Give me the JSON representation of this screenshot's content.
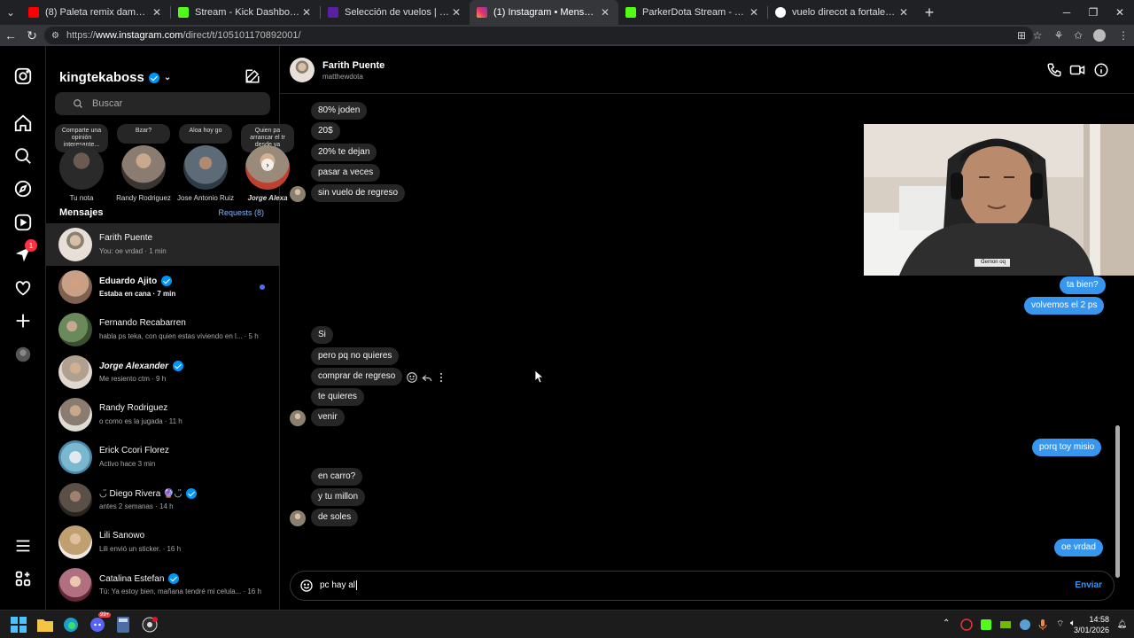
{
  "browser": {
    "tabs": [
      {
        "title": "(8) Paleta remix dame paleta palet",
        "favicon": "youtube-icon",
        "color": "#ff0000"
      },
      {
        "title": "Stream - Kick Dashboard",
        "favicon": "kick-icon",
        "color": "#53fc18"
      },
      {
        "title": "Selección de vuelos | LATAM Airlin",
        "favicon": "latam-icon",
        "color": "#5a1fa3"
      },
      {
        "title": "(1) Instagram • Mensajes",
        "favicon": "instagram-icon",
        "color": "#e1306c"
      },
      {
        "title": "ParkerDota Stream - Watch Live or",
        "favicon": "kick-icon",
        "color": "#53fc18"
      },
      {
        "title": "vuelo direcot a fortaleza de lima -",
        "favicon": "google-icon",
        "color": "#ffffff"
      }
    ],
    "url_prefix": "https://",
    "url_host": "www.instagram.com",
    "url_path": "/direct/t/105101170892001/"
  },
  "sidebar": {
    "notification_count": "1"
  },
  "inbox": {
    "username": "kingtekaboss",
    "search_placeholder": "Buscar",
    "notes": [
      {
        "bubble": "Comparte una opinión interesante...",
        "name": "Tu nota",
        "color": "#3b3b3b"
      },
      {
        "bubble": "Bzar?",
        "name": "Randy Rodriguez",
        "color": "#8a7c70"
      },
      {
        "bubble": "Aloa hoy go",
        "name": "Jose Antonio Ruiz",
        "color": "#5d6b78"
      },
      {
        "bubble": "Quien pa arrancar el tr desde ya",
        "name": "Jorge Alexa",
        "color": "#9a8a7a"
      }
    ],
    "messages_header": "Mensajes",
    "requests_link": "Requests (8)",
    "conversations": [
      {
        "name": "Farith Puente",
        "preview": "You: oe vrdad · 1 min",
        "verified": false,
        "unread": false,
        "color": "#a89b8c"
      },
      {
        "name": "Eduardo Ajito",
        "preview": "Estaba en cana · 7 min",
        "verified": true,
        "unread": true,
        "color": "#c8a088"
      },
      {
        "name": "Fernando Recabarren",
        "preview": "habla ps teka, con quien estas viviendo en l... · 5 h",
        "verified": false,
        "unread": false,
        "color": "#6b8a5c"
      },
      {
        "name": "Jorge Alexander",
        "preview": "Me resiento ctm · 9 h",
        "verified": true,
        "unread": false,
        "color": "#b0a090"
      },
      {
        "name": "Randy Rodriguez",
        "preview": "o como es la jugada · 11 h",
        "verified": false,
        "unread": false,
        "color": "#8a7c70"
      },
      {
        "name": "Erick Ccori Florez",
        "preview": "Activo hace 3 min",
        "verified": false,
        "unread": false,
        "color": "#7ab8d0"
      },
      {
        "name": "◡̈ Diego Rivera 🔮◡̈",
        "preview": "antes 2 semanas · 14 h",
        "verified": true,
        "unread": false,
        "color": "#5a5048"
      },
      {
        "name": "Lili Sanowo",
        "preview": "Lili envió un sticker. · 16 h",
        "verified": false,
        "unread": false,
        "color": "#c0a070"
      },
      {
        "name": "Catalina Estefan",
        "preview": "Tú: Ya estoy bien, mañana tendré mi celula... · 16 h",
        "verified": true,
        "unread": false,
        "color": "#b07080"
      }
    ]
  },
  "thread": {
    "name": "Farith Puente",
    "handle": "matthewdota",
    "messages": [
      {
        "dir": "in",
        "text": "80% joden"
      },
      {
        "dir": "in",
        "text": "20$"
      },
      {
        "dir": "in",
        "text": "20% te dejan"
      },
      {
        "dir": "in",
        "text": "pasar a veces"
      },
      {
        "dir": "in",
        "text": "sin vuelo de regreso"
      },
      {
        "dir": "out",
        "text": "ta bien?"
      },
      {
        "dir": "out",
        "text": "volvemos el 2 ps"
      },
      {
        "dir": "in",
        "text": "Si"
      },
      {
        "dir": "in",
        "text": "pero pq no quieres"
      },
      {
        "dir": "in",
        "text": "comprar de regreso"
      },
      {
        "dir": "in",
        "text": "te quieres"
      },
      {
        "dir": "in",
        "text": "venir"
      },
      {
        "dir": "out",
        "text": "porq toy misio"
      },
      {
        "dir": "in",
        "text": "en carro?"
      },
      {
        "dir": "in",
        "text": "y tu millon"
      },
      {
        "dir": "in",
        "text": "de soles"
      },
      {
        "dir": "out",
        "text": "oe vrdad"
      }
    ],
    "composer_text": "pc hay al",
    "send_label": "Enviar"
  },
  "webcam": {
    "shirt_text": "ᗡemon oq"
  },
  "taskbar": {
    "time": "14:58",
    "date": "3/01/2026",
    "discord_badge": "99+"
  }
}
